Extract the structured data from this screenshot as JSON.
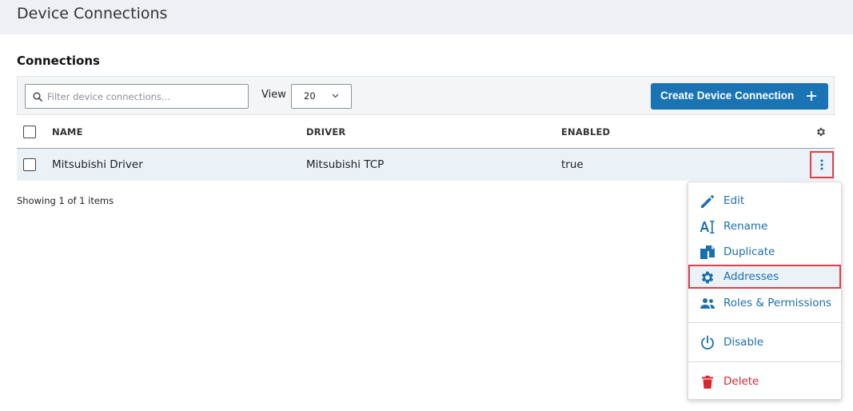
{
  "header": {
    "title": "Device Connections"
  },
  "section": {
    "title": "Connections"
  },
  "toolbar": {
    "search_placeholder": "Filter device connections...",
    "search_value": "",
    "view_label": "View",
    "view_value": "20",
    "create_label": "Create Device Connection"
  },
  "table": {
    "columns": [
      "NAME",
      "DRIVER",
      "ENABLED"
    ],
    "rows": [
      {
        "name": "Mitsubishi Driver",
        "driver": "Mitsubishi TCP",
        "enabled": "true"
      }
    ],
    "settings_icon": "gear-icon",
    "row_menu_icon": "kebab-vertical-icon"
  },
  "footer": {
    "showing": "Showing 1 of 1 items"
  },
  "menu": {
    "items": [
      {
        "label": "Edit",
        "icon": "pencil-icon"
      },
      {
        "label": "Rename",
        "icon": "rename-text-icon"
      },
      {
        "label": "Duplicate",
        "icon": "duplicate-icon"
      },
      {
        "label": "Addresses",
        "icon": "gear-icon"
      },
      {
        "label": "Roles & Permissions",
        "icon": "users-icon"
      },
      {
        "label": "Disable",
        "icon": "power-icon"
      },
      {
        "label": "Delete",
        "icon": "trash-icon"
      }
    ],
    "highlighted": "Addresses"
  },
  "colors": {
    "accent": "#1a74b4",
    "link": "#1a6fad",
    "danger": "#d9262f",
    "highlight_border": "#e04048",
    "row_bg": "#eaf2f8",
    "header_bg": "#eef0f3"
  }
}
